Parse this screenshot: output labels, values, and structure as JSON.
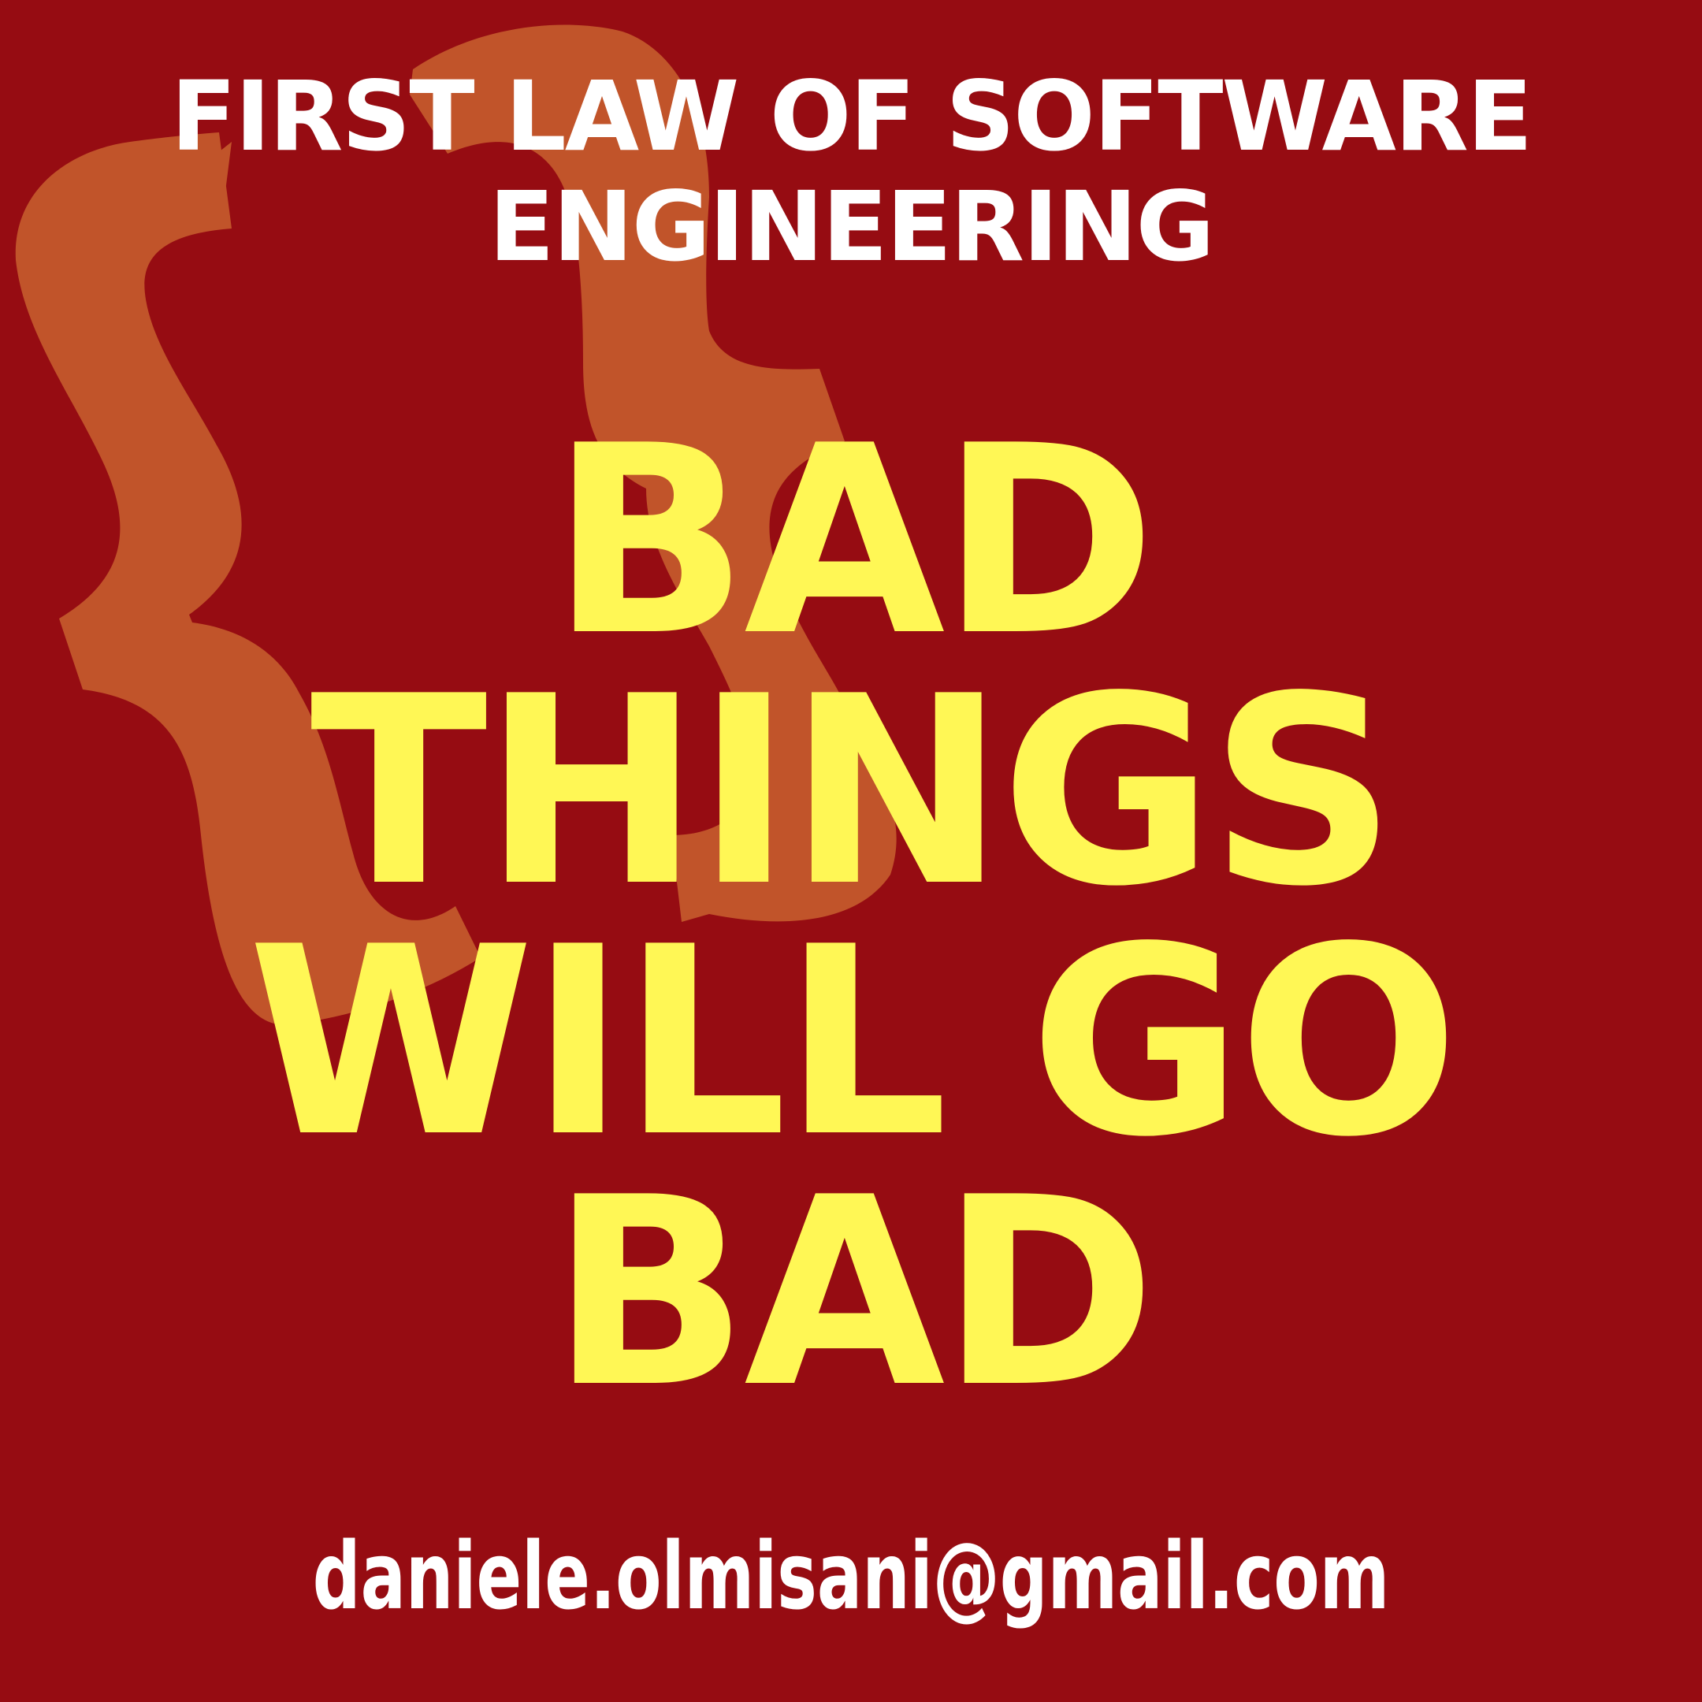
{
  "header": {
    "line1": "FIRST LAW OF SOFTWARE",
    "line2": "ENGINEERING"
  },
  "headline": {
    "line1": "BAD",
    "line2": "THINGS",
    "line3": "WILL GO",
    "line4": "BAD"
  },
  "footer": {
    "email": "daniele.olmisani@gmail.com"
  },
  "colors": {
    "background": "#960c12",
    "brace": "#c1542a",
    "header_text": "#ffffff",
    "headline_text": "#fff755",
    "footer_text": "#ffffff"
  },
  "icons": {
    "background_graphic": "curly-brace-icon"
  }
}
